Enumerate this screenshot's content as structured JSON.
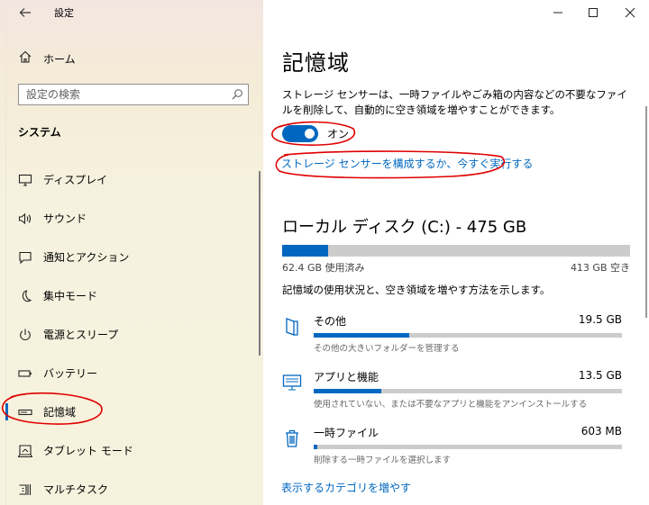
{
  "window": {
    "title": "設定",
    "controls": [
      "minimize-icon",
      "maximize-icon",
      "close-icon"
    ]
  },
  "sidebar": {
    "home_label": "ホーム",
    "search_placeholder": "設定の検索",
    "section_title": "システム",
    "items": [
      {
        "label": "ディスプレイ",
        "icon": "monitor-icon"
      },
      {
        "label": "サウンド",
        "icon": "speaker-icon"
      },
      {
        "label": "通知とアクション",
        "icon": "notification-icon"
      },
      {
        "label": "集中モード",
        "icon": "moon-icon"
      },
      {
        "label": "電源とスリープ",
        "icon": "power-icon"
      },
      {
        "label": "バッテリー",
        "icon": "battery-icon"
      },
      {
        "label": "記憶域",
        "icon": "storage-icon",
        "active": true
      },
      {
        "label": "タブレット モード",
        "icon": "tablet-mode-icon"
      },
      {
        "label": "マルチタスク",
        "icon": "multitasking-icon"
      }
    ]
  },
  "main": {
    "title": "記憶域",
    "description": "ストレージ センサーは、一時ファイルやごみ箱の内容などの不要なファイルを削除して、自動的に空き領域を増やすことができます。",
    "toggle": {
      "state": "on",
      "label": "オン"
    },
    "configure_link": "ストレージ センサーを構成するか、今すぐ実行する",
    "disk": {
      "title": "ローカル ディスク (C:) - 475 GB",
      "used_label": "62.4 GB 使用済み",
      "free_label": "413 GB 空き",
      "used_fraction": 0.131
    },
    "usage_description": "記憶域の使用状況と、空き領域を増やす方法を示します。",
    "categories": [
      {
        "name": "その他",
        "size": "19.5 GB",
        "sub": "その他の大きいフォルダーを管理する",
        "fraction": 0.31,
        "icon": "folder-other-icon"
      },
      {
        "name": "アプリと機能",
        "size": "13.5 GB",
        "sub": "使用されていない、または不要なアプリと機能をアンインストールする",
        "fraction": 0.22,
        "icon": "apps-features-icon"
      },
      {
        "name": "一時ファイル",
        "size": "603 MB",
        "sub": "削除する一時ファイルを選択します",
        "fraction": 0.012,
        "icon": "trash-icon"
      }
    ],
    "more_link": "表示するカテゴリを増やす"
  },
  "colors": {
    "accent": "#0067c0",
    "annotation": "#e00000"
  }
}
